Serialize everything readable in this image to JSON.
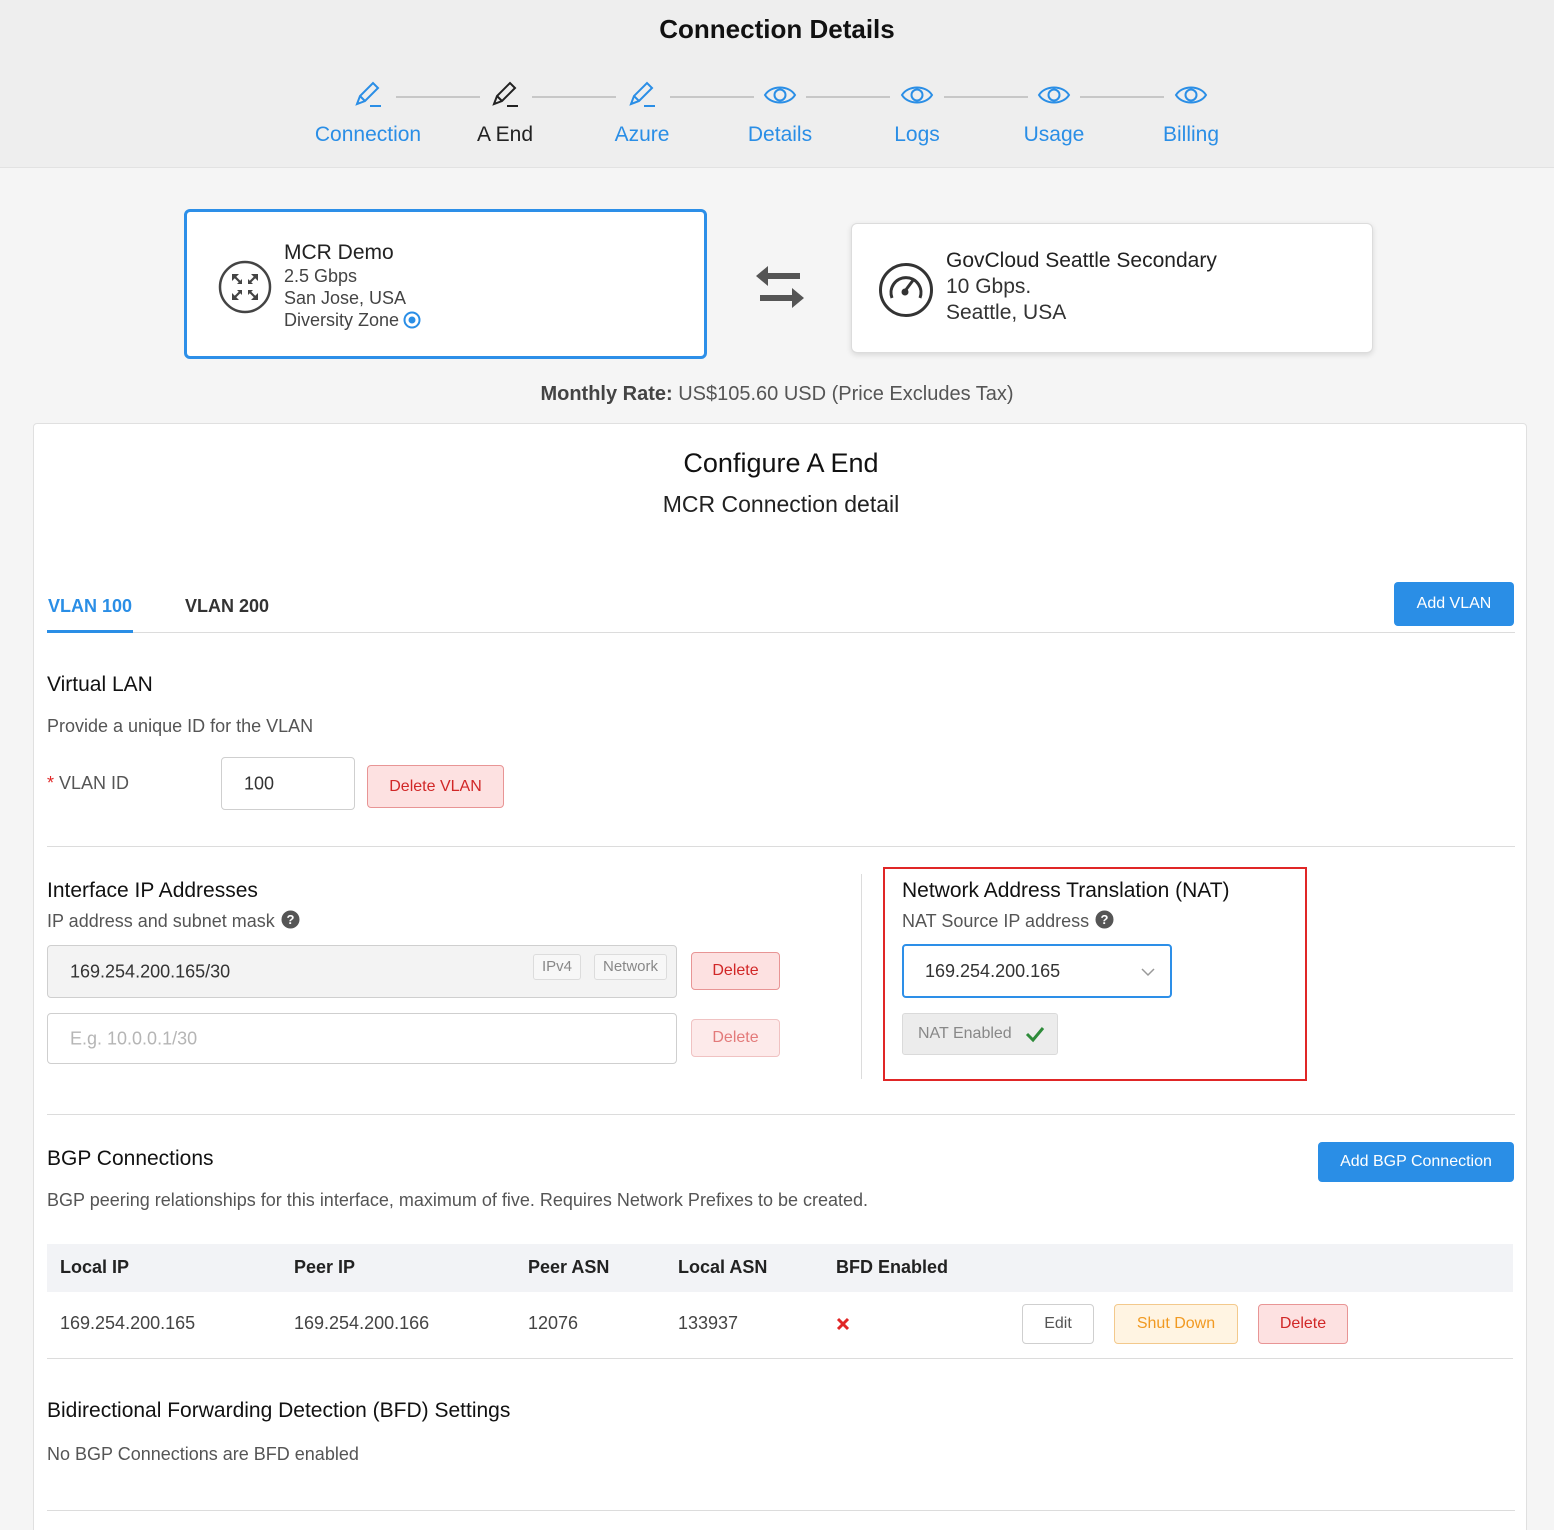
{
  "page_title": "Connection Details",
  "steps": [
    {
      "label": "Connection",
      "icon": "pencil-icon",
      "active": false
    },
    {
      "label": "A End",
      "icon": "pencil-icon",
      "active": true
    },
    {
      "label": "Azure",
      "icon": "pencil-icon",
      "active": false
    },
    {
      "label": "Details",
      "icon": "eye-icon",
      "active": false
    },
    {
      "label": "Logs",
      "icon": "eye-icon",
      "active": false
    },
    {
      "label": "Usage",
      "icon": "eye-icon",
      "active": false
    },
    {
      "label": "Billing",
      "icon": "eye-icon",
      "active": false
    }
  ],
  "a_end": {
    "name": "MCR Demo",
    "speed": "2.5 Gbps",
    "location": "San Jose, USA",
    "diversity": "Diversity Zone",
    "icon": "mcr-arrows-icon"
  },
  "b_end": {
    "name": "GovCloud Seattle Secondary",
    "speed": "10 Gbps.",
    "location": "Seattle, USA",
    "icon": "speedometer-icon"
  },
  "swap_icon": "swap-arrows-icon",
  "rate": {
    "label": "Monthly Rate:",
    "value": "US$105.60 USD (Price Excludes Tax)"
  },
  "panel": {
    "title": "Configure A End",
    "subtitle": "MCR Connection detail"
  },
  "tabs": [
    {
      "label": "VLAN 100",
      "active": true
    },
    {
      "label": "VLAN 200",
      "active": false
    }
  ],
  "add_vlan_label": "Add VLAN",
  "vlan": {
    "heading": "Virtual LAN",
    "description": "Provide a unique ID for the VLAN",
    "required_mark": "*",
    "id_label": "VLAN ID",
    "id_value": "100",
    "delete_label": "Delete VLAN"
  },
  "interface": {
    "heading": "Interface IP Addresses",
    "description": "IP address and subnet mask",
    "address_value": "169.254.200.165/30",
    "tags": [
      "IPv4",
      "Network"
    ],
    "placeholder": "E.g. 10.0.0.1/30",
    "delete_label": "Delete"
  },
  "nat": {
    "heading": "Network Address Translation (NAT)",
    "description": "NAT Source IP address",
    "selected": "169.254.200.165",
    "enabled_label": "NAT Enabled",
    "highlight_color": "#e02626"
  },
  "bgp": {
    "heading": "BGP Connections",
    "description": "BGP peering relationships for this interface, maximum of five. Requires Network Prefixes to be created.",
    "add_label": "Add BGP Connection",
    "columns": [
      "Local IP",
      "Peer IP",
      "Peer ASN",
      "Local ASN",
      "BFD Enabled"
    ],
    "rows": [
      {
        "local_ip": "169.254.200.165",
        "peer_ip": "169.254.200.166",
        "peer_asn": "12076",
        "local_asn": "133937",
        "bfd_enabled": false,
        "actions": [
          "Edit",
          "Shut Down",
          "Delete"
        ]
      }
    ]
  },
  "bfd": {
    "heading": "Bidirectional Forwarding Detection (BFD) Settings",
    "description": "No BGP Connections are BFD enabled"
  },
  "colors": {
    "accent": "#2a8ee6",
    "danger": "#d12727",
    "warning": "#f19a22",
    "success": "#2e8b3a"
  }
}
